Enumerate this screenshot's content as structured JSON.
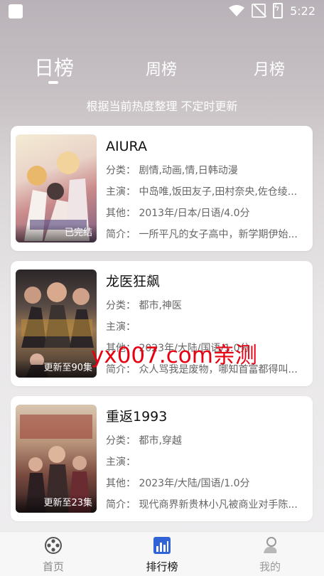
{
  "status_bar": {
    "time": "5:22"
  },
  "tabs": [
    {
      "label": "日榜",
      "active": true
    },
    {
      "label": "周榜",
      "active": false
    },
    {
      "label": "月榜",
      "active": false
    }
  ],
  "subtitle": "根据当前热度整理 不定时更新",
  "items": [
    {
      "title": "AIURA",
      "category": "分类：  剧情,动画,情,日韩动漫",
      "cast": "主演：  中岛唯,饭田友子,田村奈央,佐仓绫...",
      "other": "其他：  2013年/日本/日语/4.0分",
      "intro": "简介：  一所平凡的女子高中，新学期伊始...",
      "badge": "已完结"
    },
    {
      "title": "龙医狂飙",
      "category": "分类：  都市,神医",
      "cast": "主演：",
      "other": "其他：  2023年/大陆/国语/1.0分",
      "intro": "简介：  众人骂我是废物，哪知首富都得叫...",
      "badge": "更新至90集"
    },
    {
      "title": "重返1993",
      "category": "分类：  都市,穿越",
      "cast": "主演：",
      "other": "其他：  2023年/大陆/国语/1.0分",
      "intro": "简介：  现代商界新贵林小凡被商业对手陈...",
      "badge": "更新至23集"
    }
  ],
  "watermark": "yx007.com亲测",
  "bottom_nav": [
    {
      "label": "首页",
      "icon": "film-reel-icon",
      "active": false
    },
    {
      "label": "排行榜",
      "icon": "bar-chart-icon",
      "active": true
    },
    {
      "label": "我的",
      "icon": "profile-icon",
      "active": false
    }
  ],
  "colors": {
    "watermark": "#e60012",
    "active_nav": "#111111",
    "inactive_nav": "#888888"
  }
}
